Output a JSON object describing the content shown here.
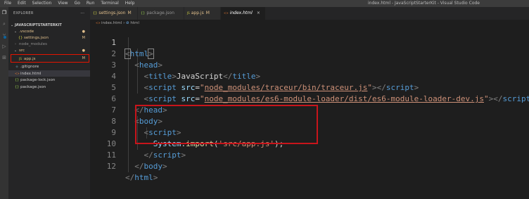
{
  "menu": [
    "File",
    "Edit",
    "Selection",
    "View",
    "Go",
    "Run",
    "Terminal",
    "Help"
  ],
  "window_title": "index.html - JavaScriptStarterKit - Visual Studio Code",
  "sidebar": {
    "header": "EXPLORER",
    "more": "···",
    "section": "JAVASCRIPTSTARTERKIT",
    "items": [
      {
        "icon": "⌄",
        "label": ".vscode",
        "status": "●"
      },
      {
        "icon": "{}",
        "label": "settings.json",
        "status": "M"
      },
      {
        "icon": "›",
        "label": "node_modules",
        "status": ""
      },
      {
        "icon": "⌄",
        "label": "src",
        "status": "●"
      },
      {
        "icon": "JS",
        "label": "app.js",
        "status": "M"
      },
      {
        "icon": "◆",
        "label": ".gitignore",
        "status": ""
      },
      {
        "icon": "<>",
        "label": "index.html",
        "status": ""
      },
      {
        "icon": "{}",
        "label": "package-lock.json",
        "status": ""
      },
      {
        "icon": "{}",
        "label": "package.json",
        "status": ""
      }
    ]
  },
  "tabs": [
    {
      "icon": "{}",
      "label": "settings.json",
      "status": "M",
      "close": ""
    },
    {
      "icon": "{}",
      "label": "package.json",
      "status": "",
      "close": ""
    },
    {
      "icon": "JS",
      "label": "app.js",
      "status": "M",
      "close": ""
    },
    {
      "icon": "<>",
      "label": "index.html",
      "status": "",
      "close": "×"
    }
  ],
  "breadcrumb": {
    "file": "index.html",
    "sep": "›",
    "symbol": "html"
  },
  "code": {
    "line_numbers": [
      "1",
      "2",
      "3",
      "4",
      "5",
      "6",
      "7",
      "8",
      "9",
      "10",
      "11",
      "12"
    ],
    "l1": {
      "open": "<",
      "tag": "html",
      "close": ">"
    },
    "l2": {
      "open": "<",
      "tag": "head",
      "close": ">"
    },
    "l3": {
      "open": "<",
      "tag": "title",
      "close": ">",
      "text": "JavaScript",
      "endopen": "</",
      "endtag": "title",
      "endclose": ">"
    },
    "l4": {
      "open": "<",
      "tag": "script",
      "attr": "src",
      "eq": "=",
      "q1": "\"",
      "val": "node_modules/traceur/bin/traceur.js",
      "q2": "\"",
      "close": ">",
      "endopen": "</",
      "endtag": "script",
      "endclose": ">"
    },
    "l5": {
      "open": "<",
      "tag": "script",
      "attr": "src",
      "eq": "=",
      "q1": "\"",
      "val": "node_modules/es6-module-loader/dist/es6-module-loader-dev.js",
      "q2": "\"",
      "close": ">",
      "endopen": "</",
      "endtag": "script",
      "endclose": ">"
    },
    "l6": {
      "open": "</",
      "tag": "head",
      "close": ">"
    },
    "l7": {
      "open": "<",
      "tag": "body",
      "close": ">"
    },
    "l8": {
      "open": "<",
      "tag": "script",
      "close": ">"
    },
    "l9": {
      "obj": "System",
      "dot": ".",
      "fn": "import",
      "p1": "(",
      "str": "'src/app.js'",
      "p2": ");"
    },
    "l10": {
      "open": "</",
      "tag": "script",
      "close": ">"
    },
    "l11": {
      "open": "</",
      "tag": "body",
      "close": ">"
    },
    "l12": {
      "open": "</",
      "tag": "html",
      "close": ">"
    }
  },
  "colors": {
    "highlight": "#e51400",
    "accent": "#0e639c",
    "modified": "#e2c08d"
  }
}
